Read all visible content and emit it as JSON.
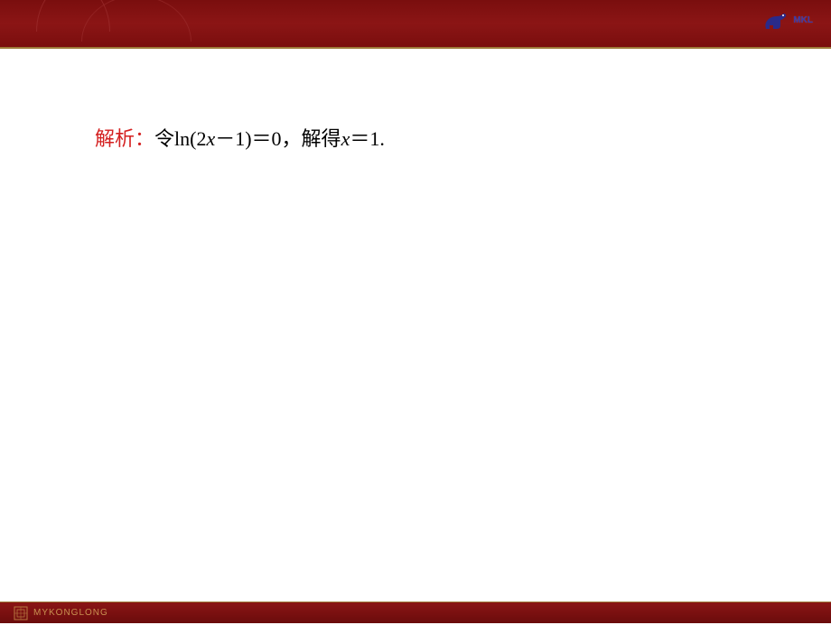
{
  "header": {
    "logo_text": "MKL"
  },
  "content": {
    "label": "解析：",
    "text_p1": "令ln(2",
    "var1": "x",
    "text_p2": "－1)＝0，解得",
    "var2": "x",
    "text_p3": "＝1."
  },
  "footer": {
    "watermark": "MYKONGLONG"
  }
}
